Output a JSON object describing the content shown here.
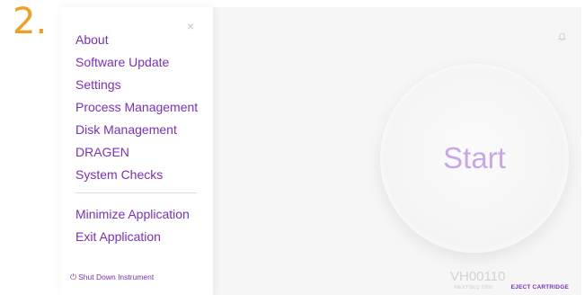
{
  "step_label": "2.",
  "sidebar": {
    "close_label": "×",
    "items": [
      {
        "label": "About"
      },
      {
        "label": "Software Update"
      },
      {
        "label": "Settings"
      },
      {
        "label": "Process Management"
      },
      {
        "label": "Disk Management"
      },
      {
        "label": "DRAGEN"
      },
      {
        "label": "System Checks"
      }
    ],
    "secondary_items": [
      {
        "label": "Minimize Application"
      },
      {
        "label": "Exit Application"
      }
    ],
    "shutdown_label": "Shut Down Instrument"
  },
  "main": {
    "start_label": "Start",
    "instrument_id": "VH00110",
    "instrument_model": "NEXTSEQ 2000",
    "eject_label": "EJECT CARTRIDGE",
    "notification_icon": "bell-icon"
  },
  "colors": {
    "accent": "#7b2fbf",
    "step_label": "#f0a020",
    "start_text": "#c9a6e6"
  }
}
